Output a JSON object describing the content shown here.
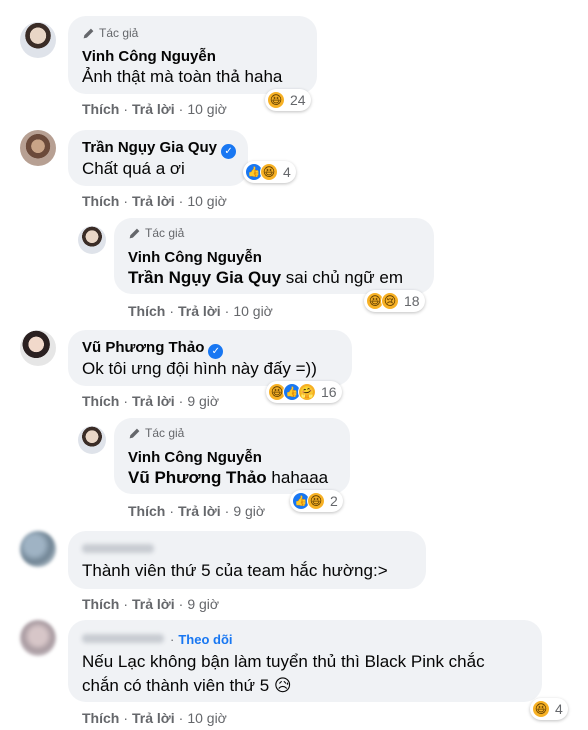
{
  "labels": {
    "tac_gia": "Tác giả",
    "thich": "Thích",
    "tra_loi": "Trả lời",
    "dot": "·",
    "theo_doi": "Theo dõi",
    "verified_glyph": "✓"
  },
  "comments": [
    {
      "author": "Vinh Công Nguyễn",
      "badge": "Tác giả",
      "text": "Ảnh thật mà toàn thả haha",
      "time": "10 giờ",
      "reaction_count": "24",
      "reactions": [
        "haha"
      ]
    },
    {
      "author": "Trần Ngụy Gia Quy",
      "verified": true,
      "text": "Chất quá a ơi",
      "time": "10 giờ",
      "reaction_count": "4",
      "reactions": [
        "like",
        "haha"
      ]
    },
    {
      "author": "Vinh Công Nguyễn",
      "badge": "Tác giả",
      "mention": "Trần Ngụy Gia Quy",
      "text": "sai chủ ngữ em",
      "time": "10 giờ",
      "reaction_count": "18",
      "reactions": [
        "haha",
        "sad"
      ]
    },
    {
      "author": "Vũ Phương Thảo",
      "verified": true,
      "text": "Ok tôi ưng đội hình này đấy =))",
      "time": "9 giờ",
      "reaction_count": "16",
      "reactions": [
        "haha",
        "like",
        "care"
      ]
    },
    {
      "author": "Vinh Công Nguyễn",
      "badge": "Tác giả",
      "mention": "Vũ Phương Thảo",
      "text": "hahaaa",
      "time": "9 giờ",
      "reaction_count": "2",
      "reactions": [
        "like",
        "haha"
      ]
    },
    {
      "author": "",
      "text": "Thành viên thứ 5 của team hắc hường:>",
      "time": "9 giờ"
    },
    {
      "author": "",
      "follow": true,
      "text_line1": "Nếu Lạc không bận làm tuyển thủ thì Black Pink chắc",
      "text_line2": "chắn có thành viên thứ 5 😥",
      "time": "10 giờ",
      "reaction_count": "4",
      "reactions": [
        "haha"
      ]
    }
  ],
  "icons": {
    "author_badge": "pencil-icon",
    "haha": "😆",
    "sad": "😢",
    "like": "👍",
    "care": "🤗"
  }
}
